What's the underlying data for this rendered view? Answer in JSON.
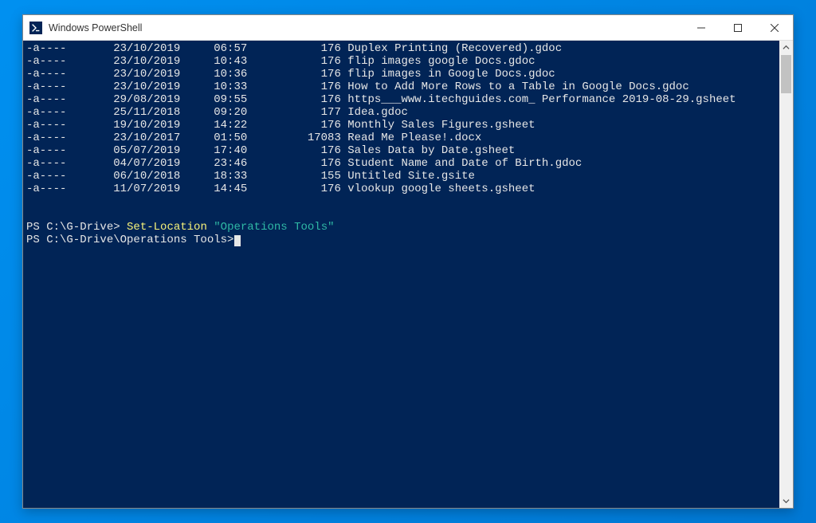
{
  "window": {
    "title": "Windows PowerShell"
  },
  "colors": {
    "terminal_bg": "#012456",
    "terminal_fg": "#e6e6e6",
    "cmdlet": "#f7f27a",
    "string": "#2fb9a5"
  },
  "listing": [
    {
      "mode": "-a----",
      "date": "23/10/2019",
      "time": "06:57",
      "length": "176",
      "name": "Duplex Printing (Recovered).gdoc"
    },
    {
      "mode": "-a----",
      "date": "23/10/2019",
      "time": "10:43",
      "length": "176",
      "name": "flip images google Docs.gdoc"
    },
    {
      "mode": "-a----",
      "date": "23/10/2019",
      "time": "10:36",
      "length": "176",
      "name": "flip images in Google Docs.gdoc"
    },
    {
      "mode": "-a----",
      "date": "23/10/2019",
      "time": "10:33",
      "length": "176",
      "name": "How to Add More Rows to a Table in Google Docs.gdoc"
    },
    {
      "mode": "-a----",
      "date": "29/08/2019",
      "time": "09:55",
      "length": "176",
      "name": "https___www.itechguides.com_ Performance 2019-08-29.gsheet"
    },
    {
      "mode": "-a----",
      "date": "25/11/2018",
      "time": "09:20",
      "length": "177",
      "name": "Idea.gdoc"
    },
    {
      "mode": "-a----",
      "date": "19/10/2019",
      "time": "14:22",
      "length": "176",
      "name": "Monthly Sales Figures.gsheet"
    },
    {
      "mode": "-a----",
      "date": "23/10/2017",
      "time": "01:50",
      "length": "17083",
      "name": "Read Me Please!.docx"
    },
    {
      "mode": "-a----",
      "date": "05/07/2019",
      "time": "17:40",
      "length": "176",
      "name": "Sales Data by Date.gsheet"
    },
    {
      "mode": "-a----",
      "date": "04/07/2019",
      "time": "23:46",
      "length": "176",
      "name": "Student Name and Date of Birth.gdoc"
    },
    {
      "mode": "-a----",
      "date": "06/10/2018",
      "time": "18:33",
      "length": "155",
      "name": "Untitled Site.gsite"
    },
    {
      "mode": "-a----",
      "date": "11/07/2019",
      "time": "14:45",
      "length": "176",
      "name": "vlookup google sheets.gsheet"
    }
  ],
  "prompt1": {
    "prefix": "PS C:\\G-Drive> ",
    "cmd": "Set-Location",
    "arg": "\"Operations Tools\""
  },
  "prompt2": {
    "prefix": "PS C:\\G-Drive\\Operations Tools>"
  }
}
